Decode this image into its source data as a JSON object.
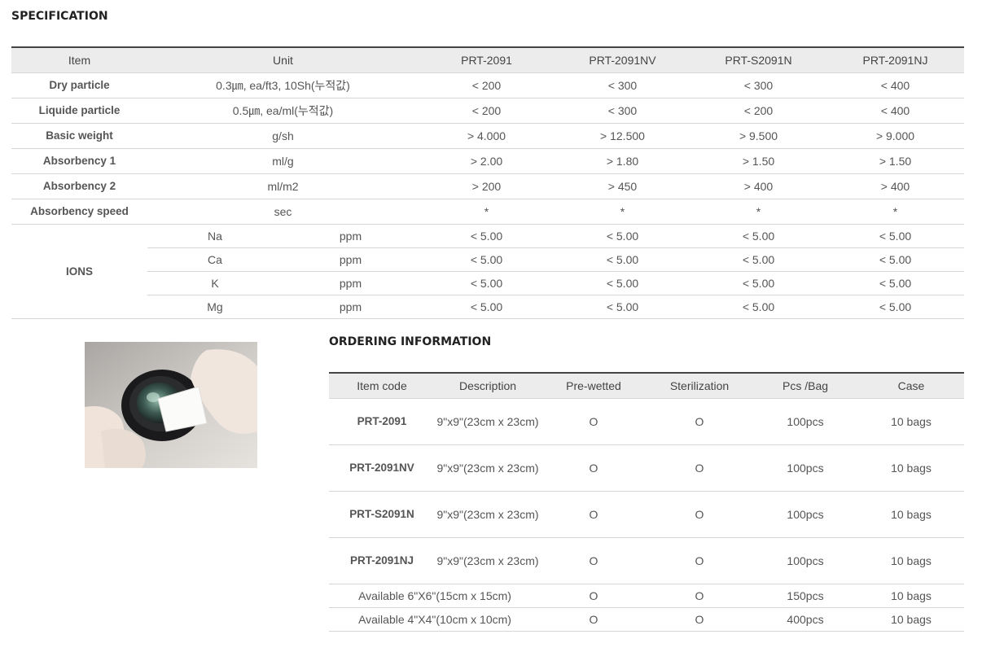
{
  "specification": {
    "title": "SPECIFICATION",
    "headers": [
      "Item",
      "Unit",
      "PRT-2091",
      "PRT-2091NV",
      "PRT-S2091N",
      "PRT-2091NJ"
    ],
    "rows": [
      {
        "item": "Dry particle",
        "unit": "0.3㎛, ea/ft3, 10Sh(누적값)",
        "values": [
          "< 200",
          "< 300",
          "< 300",
          "< 400"
        ]
      },
      {
        "item": "Liquide particle",
        "unit": "0.5㎛, ea/ml(누적값)",
        "values": [
          "< 200",
          "< 300",
          "< 200",
          "< 400"
        ]
      },
      {
        "item": "Basic weight",
        "unit": "g/sh",
        "values": [
          "> 4.000",
          "> 12.500",
          "> 9.500",
          "> 9.000"
        ]
      },
      {
        "item": "Absorbency 1",
        "unit": "ml/g",
        "values": [
          "> 2.00",
          "> 1.80",
          "> 1.50",
          "> 1.50"
        ]
      },
      {
        "item": "Absorbency 2",
        "unit": "ml/m2",
        "values": [
          "> 200",
          "> 450",
          "> 400",
          "> 400"
        ]
      },
      {
        "item": "Absorbency speed",
        "unit": "sec",
        "values": [
          "*",
          "*",
          "*",
          "*"
        ]
      }
    ],
    "ions": {
      "label": "IONS",
      "rows": [
        {
          "ion": "Na",
          "unit": "ppm",
          "values": [
            "< 5.00",
            "< 5.00",
            "< 5.00",
            "< 5.00"
          ]
        },
        {
          "ion": "Ca",
          "unit": "ppm",
          "values": [
            "< 5.00",
            "< 5.00",
            "< 5.00",
            "< 5.00"
          ]
        },
        {
          "ion": "K",
          "unit": "ppm",
          "values": [
            "< 5.00",
            "< 5.00",
            "< 5.00",
            "< 5.00"
          ]
        },
        {
          "ion": "Mg",
          "unit": "ppm",
          "values": [
            "< 5.00",
            "< 5.00",
            "< 5.00",
            "< 5.00"
          ]
        }
      ]
    }
  },
  "ordering": {
    "title": "ORDERING INFORMATION",
    "headers": [
      "Item code",
      "Description",
      "Pre-wetted",
      "Sterilization",
      "Pcs /Bag",
      "Case"
    ],
    "rows": [
      {
        "code": "PRT-2091",
        "description": "9\"x9\"(23cm x 23cm)",
        "prewetted": "O",
        "sterilization": "O",
        "pcs": "100pcs",
        "case": "10 bags"
      },
      {
        "code": "PRT-2091NV",
        "description": "9\"x9\"(23cm x 23cm)",
        "prewetted": "O",
        "sterilization": "O",
        "pcs": "100pcs",
        "case": "10 bags"
      },
      {
        "code": "PRT-S2091N",
        "description": "9\"x9\"(23cm x 23cm)",
        "prewetted": "O",
        "sterilization": "O",
        "pcs": "100pcs",
        "case": "10 bags"
      },
      {
        "code": "PRT-2091NJ",
        "description": "9\"x9\"(23cm x 23cm)",
        "prewetted": "O",
        "sterilization": "O",
        "pcs": "100pcs",
        "case": "10 bags"
      }
    ],
    "extra_rows": [
      {
        "description": "Available 6\"X6\"(15cm x 15cm)",
        "prewetted": "O",
        "sterilization": "O",
        "pcs": "150pcs",
        "case": "10 bags"
      },
      {
        "description": "Available 4\"X4\"(10cm x 10cm)",
        "prewetted": "O",
        "sterilization": "O",
        "pcs": "400pcs",
        "case": "10 bags"
      }
    ]
  },
  "image": {
    "subject": "gloved-hands-wiping-camera-lens"
  }
}
